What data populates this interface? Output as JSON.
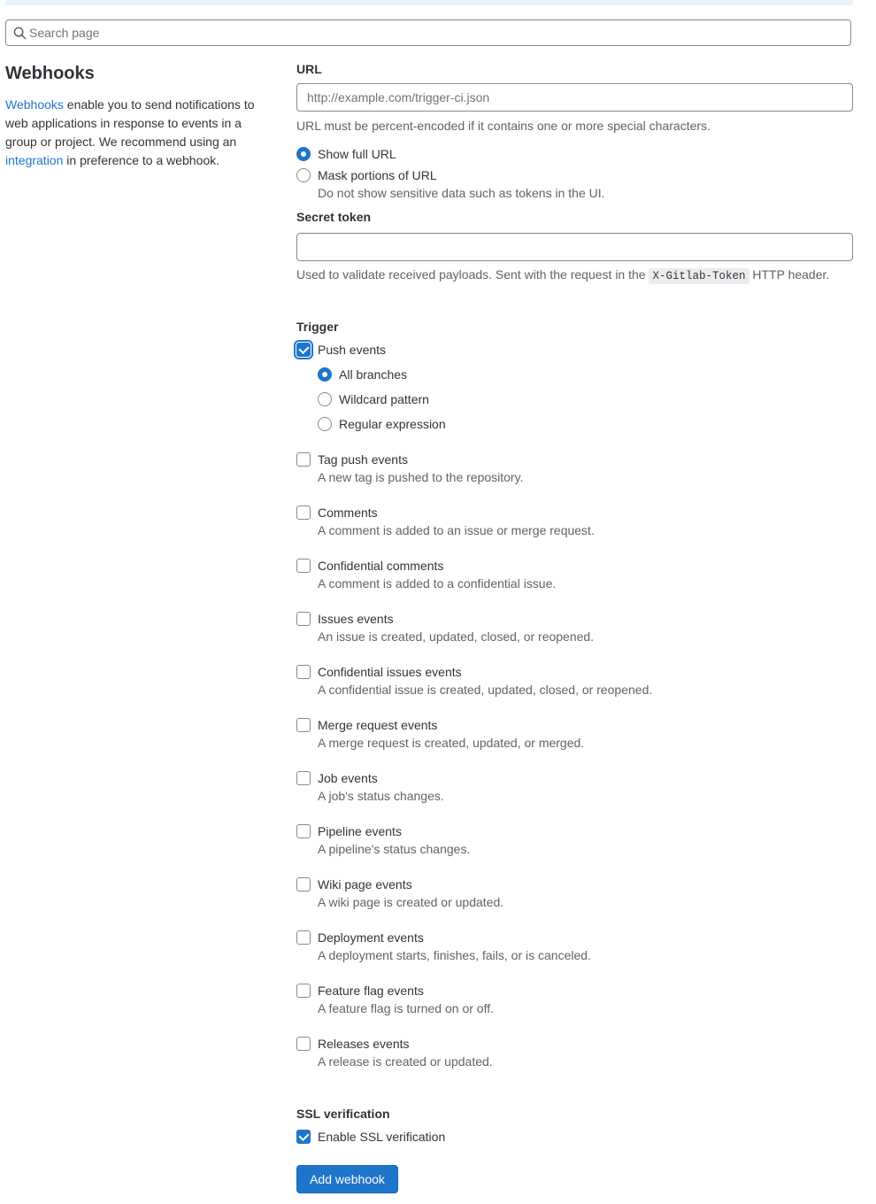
{
  "search": {
    "placeholder": "Search page"
  },
  "intro": {
    "title": "Webhooks",
    "link1": "Webhooks",
    "text1": " enable you to send notifications to web applications in response to events in a group or project. We recommend using an ",
    "link2": "integration",
    "text2": " in preference to a webhook."
  },
  "url": {
    "label": "URL",
    "placeholder": "http://example.com/trigger-ci.json",
    "help": "URL must be percent-encoded if it contains one or more special characters.",
    "options": [
      {
        "label": "Show full URL",
        "checked": true
      },
      {
        "label": "Mask portions of URL",
        "help": "Do not show sensitive data such as tokens in the UI.",
        "checked": false
      }
    ]
  },
  "secret": {
    "label": "Secret token",
    "help_before": "Used to validate received payloads. Sent with the request in the ",
    "code": "X-Gitlab-Token",
    "help_after": " HTTP header."
  },
  "trigger": {
    "label": "Trigger",
    "push": {
      "label": "Push events",
      "checked": true,
      "branches": [
        {
          "label": "All branches",
          "checked": true
        },
        {
          "label": "Wildcard pattern",
          "checked": false
        },
        {
          "label": "Regular expression",
          "checked": false
        }
      ]
    },
    "events": [
      {
        "label": "Tag push events",
        "help": "A new tag is pushed to the repository."
      },
      {
        "label": "Comments",
        "help": "A comment is added to an issue or merge request."
      },
      {
        "label": "Confidential comments",
        "help": "A comment is added to a confidential issue."
      },
      {
        "label": "Issues events",
        "help": "An issue is created, updated, closed, or reopened."
      },
      {
        "label": "Confidential issues events",
        "help": "A confidential issue is created, updated, closed, or reopened."
      },
      {
        "label": "Merge request events",
        "help": "A merge request is created, updated, or merged."
      },
      {
        "label": "Job events",
        "help": "A job's status changes."
      },
      {
        "label": "Pipeline events",
        "help": "A pipeline's status changes."
      },
      {
        "label": "Wiki page events",
        "help": "A wiki page is created or updated."
      },
      {
        "label": "Deployment events",
        "help": "A deployment starts, finishes, fails, or is canceled."
      },
      {
        "label": "Feature flag events",
        "help": "A feature flag is turned on or off."
      },
      {
        "label": "Releases events",
        "help": "A release is created or updated."
      }
    ]
  },
  "ssl": {
    "label": "SSL verification",
    "option": "Enable SSL verification",
    "checked": true
  },
  "submit": {
    "label": "Add webhook"
  },
  "colors": {
    "accent": "#1f75cb",
    "text": "#333238",
    "muted": "#626168"
  }
}
